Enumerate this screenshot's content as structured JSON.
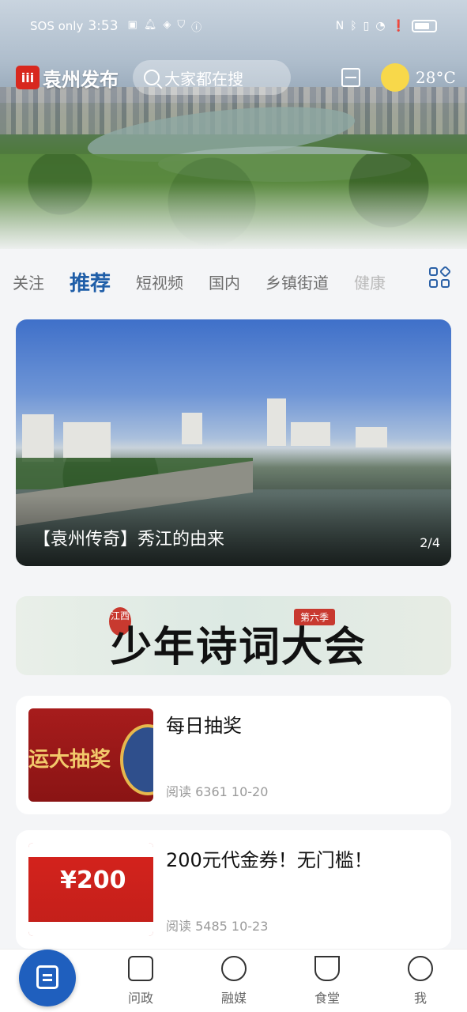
{
  "status_bar": {
    "carrier": "SOS only",
    "time": "3:53",
    "right_icons": [
      "nfc-icon",
      "bluetooth-icon",
      "vibrate-icon",
      "wifi-icon",
      "alert-icon",
      "battery-icon"
    ]
  },
  "header": {
    "logo_mark": "iii",
    "logo_text": "袁州发布",
    "search_placeholder": "大家都在搜",
    "temperature": "28°C",
    "weather_icon": "sun-icon"
  },
  "tabs": [
    {
      "label": "关注",
      "active": false
    },
    {
      "label": "推荐",
      "active": true
    },
    {
      "label": "短视频",
      "active": false
    },
    {
      "label": "国内",
      "active": false
    },
    {
      "label": "乡镇街道",
      "active": false
    },
    {
      "label": "健康",
      "active": false
    }
  ],
  "carousel": {
    "title": "【袁州传奇】秀江的由来",
    "pager": "2/4"
  },
  "banner": {
    "title": "少年诗词大会",
    "badge_jx": "江西",
    "badge_season": "第六季"
  },
  "articles": [
    {
      "title": "每日抽奖",
      "meta": "阅读 6361  10-20",
      "thumb_text": "运大抽奖"
    },
    {
      "title": "200元代金券！无门槛！",
      "meta": "阅读 5485  10-23",
      "thumb_text": "¥200"
    }
  ],
  "bottom_nav": [
    {
      "label": "问政",
      "icon": "question-icon"
    },
    {
      "label": "融媒",
      "icon": "media-icon"
    },
    {
      "label": "食堂",
      "icon": "bowl-icon"
    },
    {
      "label": "我",
      "icon": "profile-icon"
    }
  ],
  "colors": {
    "accent": "#1f5ea8",
    "brand_red": "#d8281e",
    "fab_blue": "#1f5fbe"
  }
}
